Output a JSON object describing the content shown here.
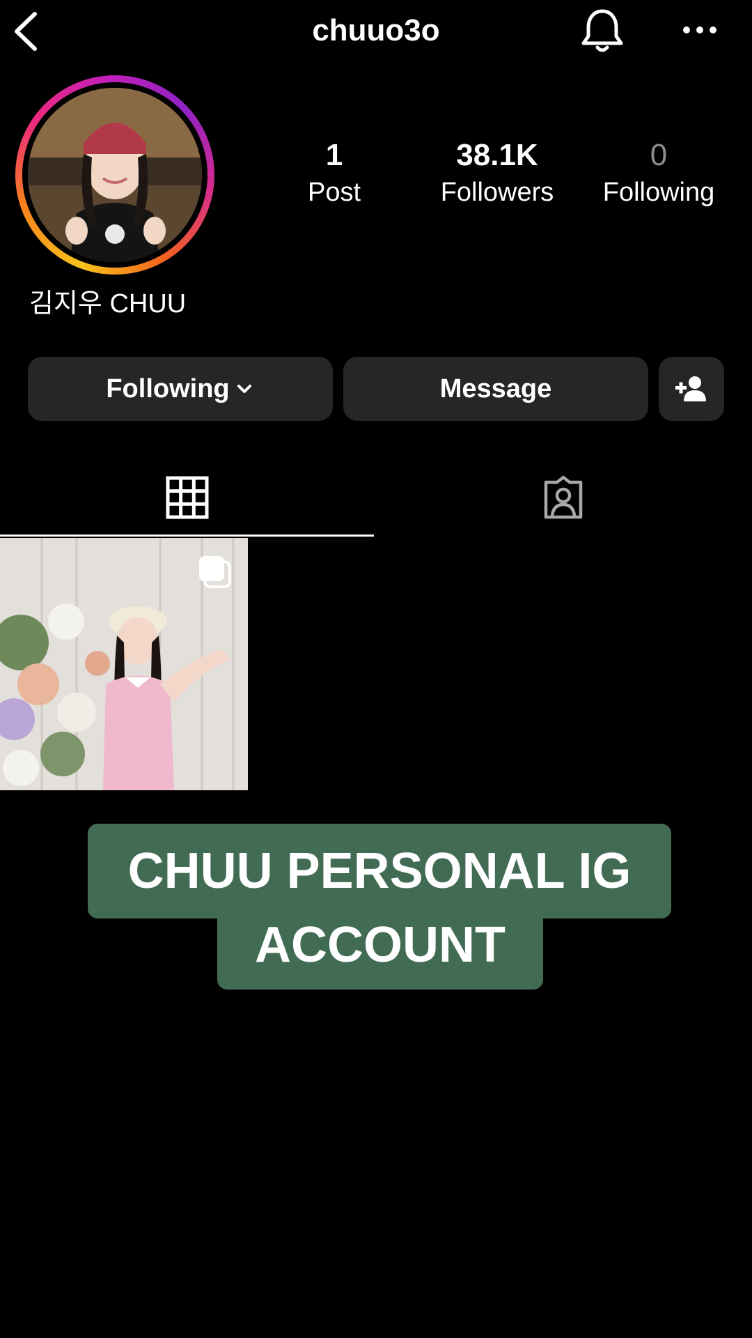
{
  "header": {
    "username": "chuuo3o",
    "back_icon": "chevron-left-icon",
    "bell_icon": "bell-icon",
    "more_icon": "more-horizontal-icon"
  },
  "profile": {
    "display_name": "김지우 CHUU",
    "stats": {
      "posts_count": "1",
      "posts_label": "Post",
      "followers_count": "38.1K",
      "followers_label": "Followers",
      "following_count": "0",
      "following_label": "Following"
    }
  },
  "actions": {
    "following_label": "Following",
    "message_label": "Message",
    "add_person_icon": "add-person-icon"
  },
  "tabs": {
    "grid_icon": "grid-icon",
    "tagged_icon": "tagged-person-icon"
  },
  "caption": {
    "line1": "CHUU PERSONAL IG",
    "line2": "ACCOUNT"
  },
  "colors": {
    "background": "#000000",
    "button_bg": "#262626",
    "caption_bg": "#426b54",
    "muted": "#8e8e8e"
  }
}
